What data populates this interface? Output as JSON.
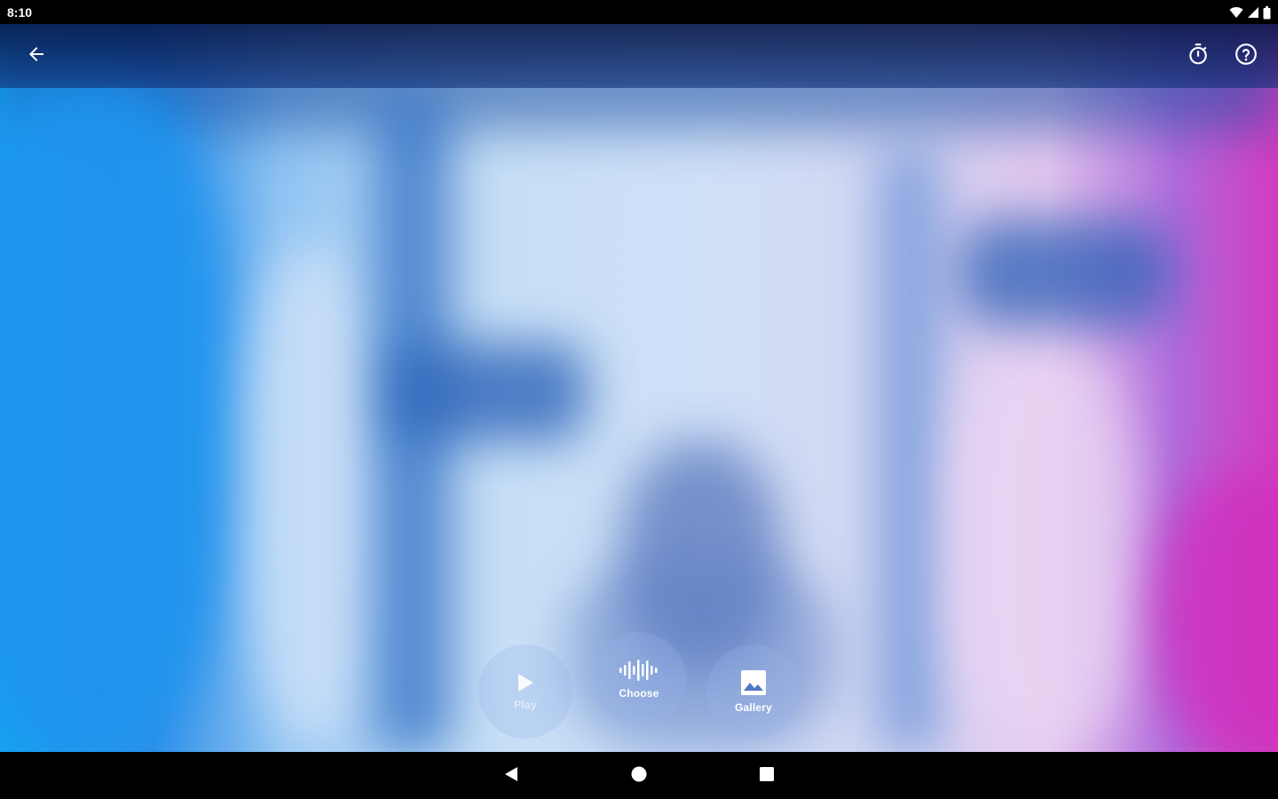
{
  "status_bar": {
    "time": "8:10",
    "icons": [
      "wifi-icon",
      "signal-icon",
      "battery-icon"
    ]
  },
  "top_bar": {
    "back_icon": "arrow-back-icon",
    "actions": [
      "timer-icon",
      "help-icon"
    ]
  },
  "controls": {
    "play": {
      "label": "Play",
      "icon": "play-icon"
    },
    "choose": {
      "label": "Choose",
      "icon": "waveform-icon"
    },
    "gallery": {
      "label": "Gallery",
      "icon": "image-icon"
    }
  },
  "nav_bar": {
    "buttons": [
      "nav-back-icon",
      "nav-home-icon",
      "nav-recents-icon"
    ]
  },
  "colors": {
    "icon_color": "#ffffff",
    "top_bar_dark": "#061646",
    "accent_blue": "#1e94ee",
    "accent_magenta": "#d23bc0"
  }
}
